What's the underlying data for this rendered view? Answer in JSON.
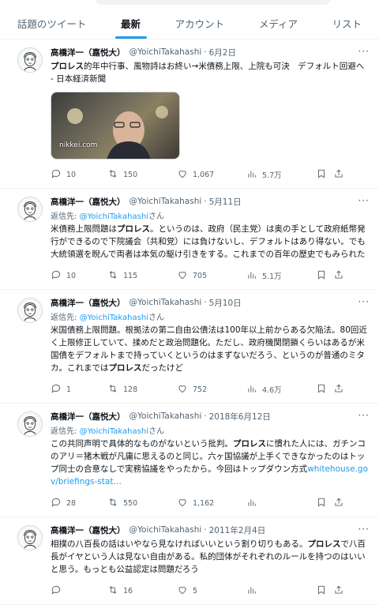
{
  "tabs": [
    {
      "label": "話題のツイート"
    },
    {
      "label": "最新"
    },
    {
      "label": "アカウント"
    },
    {
      "label": "メディア"
    },
    {
      "label": "リスト"
    }
  ],
  "active_tab": "最新",
  "colors": {
    "accent": "#1d9bf0",
    "muted": "#536471",
    "text": "#0f1419"
  },
  "tweets": [
    {
      "name": "高橋洋一（嘉悦大）",
      "handle": "@YoichiTakahashi",
      "date": "6月2日",
      "reply_to": "",
      "text_pre": "",
      "highlight": "プロレス",
      "text_post": "的年中行事、風物詩はお終い→米債務上限、上院も可決　デフォルト回避へ - 日本経済新聞",
      "media_site": "nikkei.com",
      "replies": "10",
      "retweets": "150",
      "likes": "1,067",
      "views": "5.7万"
    },
    {
      "name": "高橋洋一（嘉悦大）",
      "handle": "@YoichiTakahashi",
      "date": "5月11日",
      "reply_to": "@YoichiTakahashi",
      "text_pre": "米債務上限問題は",
      "highlight": "プロレス",
      "text_post": "。というのは、政府（民主党）は奥の手として政府紙幣発行ができるので下院議会（共和党）には負けないし、デフォルトはあり得ない。でも大統領選を睨んで両者は本気の駆け引きをする。これまでの百年の歴史でもみられた",
      "replies": "10",
      "retweets": "115",
      "likes": "705",
      "views": "5.1万"
    },
    {
      "name": "高橋洋一（嘉悦大）",
      "handle": "@YoichiTakahashi",
      "date": "5月10日",
      "reply_to": "@YoichiTakahashi",
      "text_pre": "米国債務上限問題。根拠法の第二自由公債法は100年以上前からある欠陥法。80回近く上限修正していて、揉めだと政治問題化。ただし、政府機関閉鎖くらいはあるが米国債をデフォルトまで持っていくというのはまずないだろう、というのが普通のミタカ。これまでは",
      "highlight": "プロレス",
      "text_post": "だったけど",
      "replies": "1",
      "retweets": "128",
      "likes": "752",
      "views": "4.6万"
    },
    {
      "name": "高橋洋一（嘉悦大）",
      "handle": "@YoichiTakahashi",
      "date": "2018年6月12日",
      "reply_to": "@YoichiTakahashi",
      "text_pre": "この共同声明で具体的なものがないという批判。",
      "highlight": "プロレス",
      "text_post": "に慣れた人には、ガチンコのアリ＝猪木戦が凡庸に思えるのと同じ。六ヶ国協議が上手くできなかったのはトップ同士の合意なしで実務協議をやったから。今回はトップダウン方式",
      "link": "whitehouse.gov/briefings-stat…",
      "replies": "28",
      "retweets": "550",
      "likes": "1,162",
      "views": ""
    },
    {
      "name": "高橋洋一（嘉悦大）",
      "handle": "@YoichiTakahashi",
      "date": "2011年2月4日",
      "reply_to": "",
      "text_pre": "相撲の八百長の話はいやなら見なければいいという割り切りもある。",
      "highlight": "プロレス",
      "text_post": "で八百長がイヤという人は見ない自由がある。私的団体がそれぞれのルールを持つのはいいと思う。もっとも公益認定は問題だろう",
      "replies": "",
      "retweets": "16",
      "likes": "5",
      "views": ""
    }
  ],
  "labels": {
    "reply_prefix": "返信先: ",
    "reply_suffix": "さん",
    "more": "···",
    "dot": "·"
  }
}
